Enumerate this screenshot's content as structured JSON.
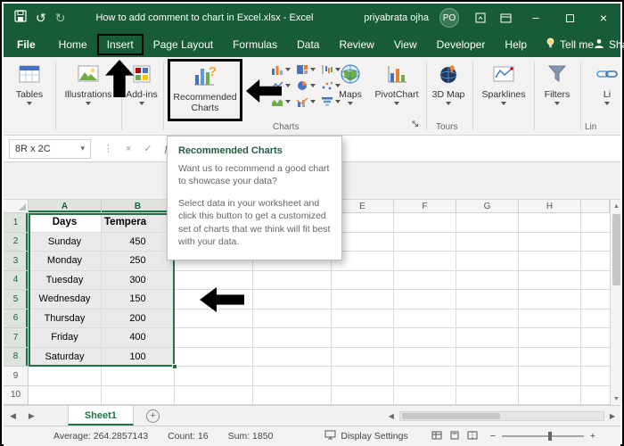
{
  "titlebar": {
    "title": "How to add comment to chart in Excel.xlsx  -  Excel",
    "user_name": "priyabrata ojha",
    "avatar_initials": "PO"
  },
  "tabs": {
    "items": [
      "File",
      "Home",
      "Insert",
      "Page Layout",
      "Formulas",
      "Data",
      "Review",
      "View",
      "Developer",
      "Help"
    ],
    "active": "Insert",
    "tell_me": "Tell me",
    "share": "Share"
  },
  "ribbon": {
    "tables": "Tables",
    "illustrations": "Illustrations",
    "addins": "Add-ins",
    "recommended_charts": "Recommended Charts",
    "maps": "Maps",
    "pivotchart": "PivotChart",
    "map3d": "3D Map",
    "sparklines": "Sparklines",
    "filters": "Filters",
    "links_partial": "Li",
    "group_charts": "Charts",
    "group_tours": "Tours",
    "group_links_partial": "Lin"
  },
  "formula_bar": {
    "name_box": "8R x 2C"
  },
  "tooltip": {
    "title": "Recommended Charts",
    "body1": "Want us to recommend a good chart to showcase your data?",
    "body2": "Select data in your worksheet and click this button to get a customized set of charts that we think will fit best with your data."
  },
  "grid": {
    "col_headers": [
      "A",
      "B",
      "C",
      "D",
      "E",
      "F",
      "G",
      "H"
    ],
    "row_headers": [
      "1",
      "2",
      "3",
      "4",
      "5",
      "6",
      "7",
      "8",
      "9",
      "10"
    ],
    "rows": [
      {
        "a": "Days",
        "b": "Tempera"
      },
      {
        "a": "Sunday",
        "b": "450"
      },
      {
        "a": "Monday",
        "b": "250"
      },
      {
        "a": "Tuesday",
        "b": "300"
      },
      {
        "a": "Wednesday",
        "b": "150"
      },
      {
        "a": "Thursday",
        "b": "200"
      },
      {
        "a": "Friday",
        "b": "400"
      },
      {
        "a": "Saturday",
        "b": "100"
      }
    ]
  },
  "sheet_bar": {
    "sheet_name": "Sheet1"
  },
  "status_bar": {
    "average": "Average: 264.2857143",
    "count": "Count: 16",
    "sum": "Sum: 1850",
    "display_settings": "Display Settings"
  },
  "icons": {
    "undo": "↺",
    "redo": "↻",
    "minimize": "−",
    "close": "×",
    "dropdown": "▾",
    "dots": "⋮",
    "cancel": "×",
    "check": "✓",
    "fx": "fx",
    "left": "◀",
    "right": "▶",
    "up": "▲",
    "down": "▼",
    "plus": "+",
    "minus": "−",
    "question": "?"
  },
  "colors": {
    "title_green": "#185c37",
    "accent_green": "#217346",
    "selection_fill": "#e9e9e9",
    "annotation_black": "#000000"
  }
}
